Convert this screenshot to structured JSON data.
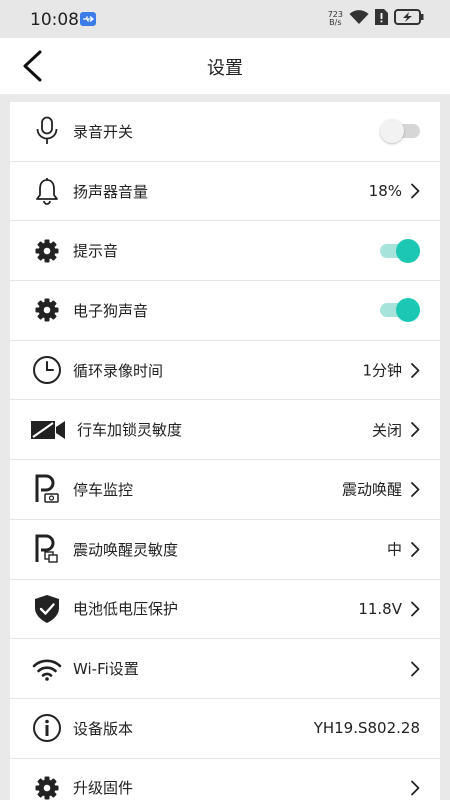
{
  "status_bar": {
    "time": "10:08",
    "net_speed_value": "723",
    "net_speed_unit": "B/s"
  },
  "header": {
    "title": "设置"
  },
  "settings": {
    "recording": {
      "label": "录音开关",
      "toggle": "off"
    },
    "speaker_volume": {
      "label": "扬声器音量",
      "value": "18%"
    },
    "prompt_sound": {
      "label": "提示音",
      "toggle": "on"
    },
    "edog_sound": {
      "label": "电子狗声音",
      "toggle": "on"
    },
    "loop_recording": {
      "label": "循环录像时间",
      "value": "1分钟"
    },
    "lock_sensitivity": {
      "label": "行车加锁灵敏度",
      "value": "关闭"
    },
    "parking_monitor": {
      "label": "停车监控",
      "value": "震动唤醒"
    },
    "wake_sensitivity": {
      "label": "震动唤醒灵敏度",
      "value": "中"
    },
    "battery_protect": {
      "label": "电池低电压保护",
      "value": "11.8V"
    },
    "wifi": {
      "label": "Wi-Fi设置"
    },
    "device_version": {
      "label": "设备版本",
      "value": "YH19.S802.28"
    },
    "firmware_upgrade": {
      "label": "升级固件"
    }
  },
  "colors": {
    "accent": "#1cc8b4",
    "accent_track": "#a6e3da",
    "background": "#e9e9e9"
  }
}
